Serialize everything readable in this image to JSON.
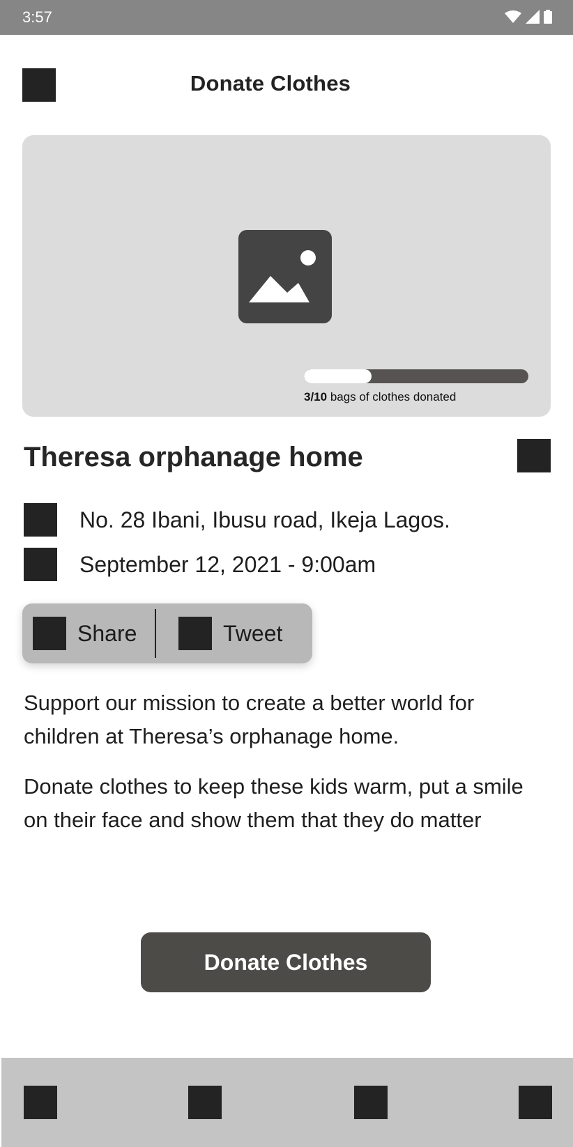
{
  "status_bar": {
    "time": "3:57"
  },
  "header": {
    "title": "Donate Clothes"
  },
  "hero": {
    "progress": {
      "current": "3/10",
      "label_rest": " bags of clothes donated",
      "fraction": 0.3
    }
  },
  "organization": {
    "name": "Theresa orphanage home",
    "address": "No. 28 Ibani, Ibusu road, Ikeja Lagos.",
    "date": "September 12, 2021 - 9:00am"
  },
  "share": {
    "share_label": "Share",
    "tweet_label": "Tweet"
  },
  "description": [
    "Support our mission to create a better world for children at Theresa’s orphanage home.",
    "Donate clothes to keep these kids warm, put a smile on their face and show them that they do matter"
  ],
  "cta": {
    "label": "Donate Clothes"
  },
  "colors": {
    "status_bar": "#868686",
    "button": "#4d4b48",
    "placeholder": "#232323",
    "hero_bg": "#dcdcdc",
    "nav_bg": "#c4c4c4"
  }
}
